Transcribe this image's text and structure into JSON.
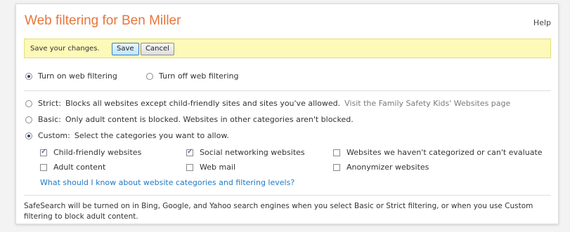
{
  "header": {
    "title": "Web filtering for Ben Miller",
    "help": "Help"
  },
  "save_bar": {
    "message": "Save your changes.",
    "save_label": "Save",
    "cancel_label": "Cancel"
  },
  "filtering_toggle": {
    "on_label": "Turn on web filtering",
    "off_label": "Turn off web filtering",
    "selected": "on"
  },
  "levels": {
    "strict": {
      "label": "Strict:",
      "description": "Blocks all websites except child-friendly sites and sites you've allowed.",
      "link": "Visit the Family Safety Kids' Websites page"
    },
    "basic": {
      "label": "Basic:",
      "description": "Only adult content is blocked. Websites in other categories aren't blocked."
    },
    "custom": {
      "label": "Custom:",
      "description": "Select the categories you want to allow."
    },
    "selected": "custom"
  },
  "categories": [
    {
      "label": "Child-friendly websites",
      "checked": true
    },
    {
      "label": "Social networking websites",
      "checked": true
    },
    {
      "label": "Websites we haven't categorized or can't evaluate",
      "checked": false
    },
    {
      "label": "Adult content",
      "checked": false
    },
    {
      "label": "Web mail",
      "checked": false
    },
    {
      "label": "Anonymizer websites",
      "checked": false
    }
  ],
  "categories_link": "What should I know about website categories and filtering levels?",
  "safesearch_note": "SafeSearch will be turned on in Bing, Google, and Yahoo search engines when you select Basic or Strict filtering, or when you use Custom filtering to block adult content.",
  "colors": {
    "title": "#e8763a",
    "save_bar_bg": "#fdf9b8",
    "link": "#1f78c8"
  }
}
